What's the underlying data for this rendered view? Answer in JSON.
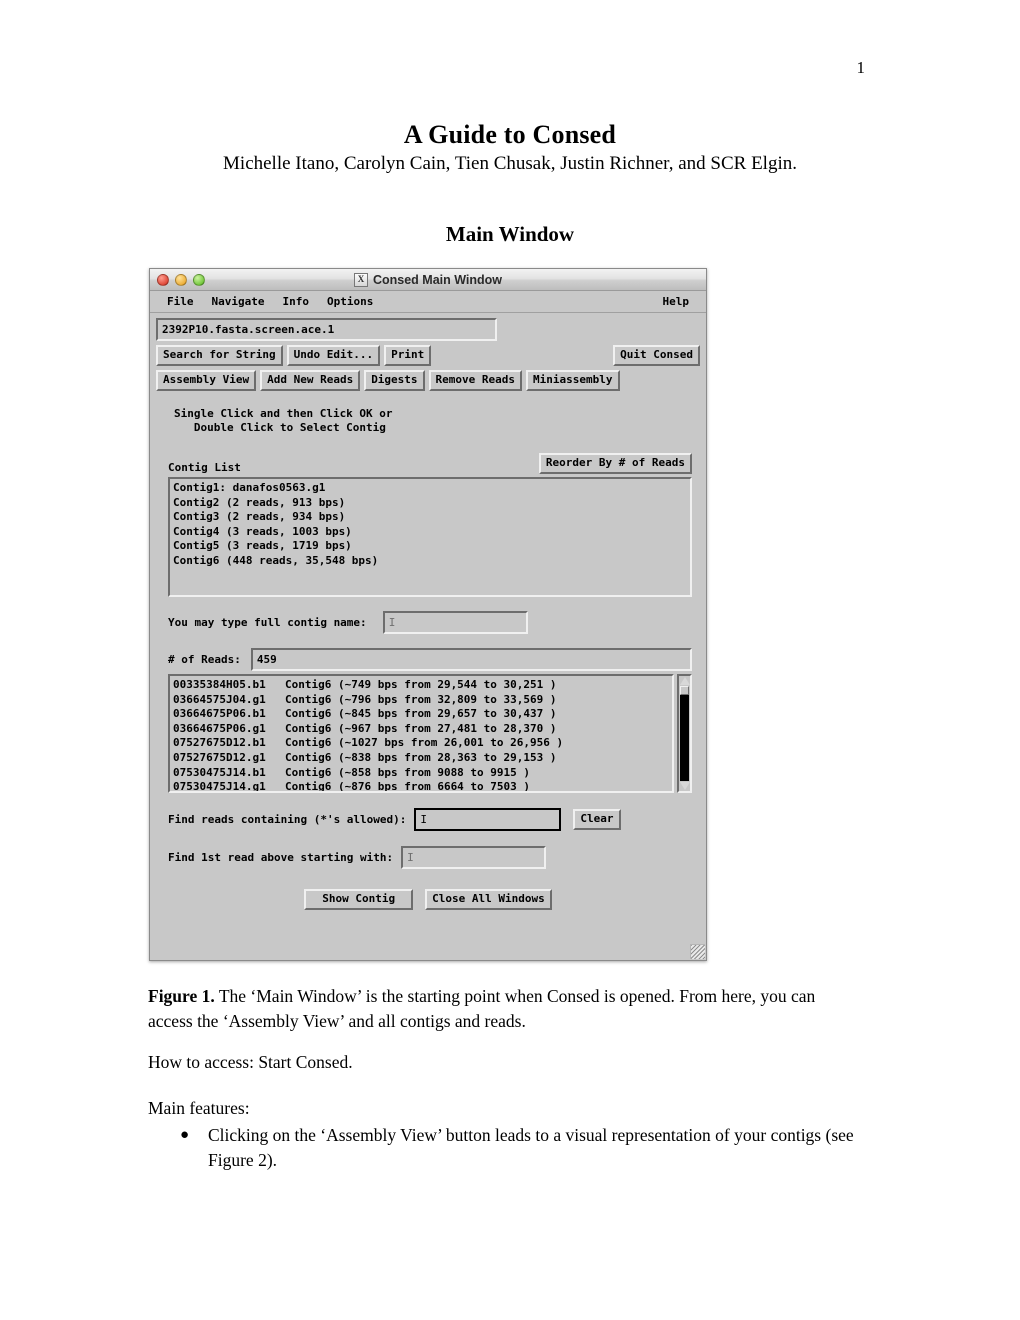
{
  "document": {
    "page_number": "1",
    "title": "A Guide to Consed",
    "authors": "Michelle Itano, Carolyn Cain, Tien Chusak, Justin Richner, and SCR Elgin.",
    "section_heading": "Main Window",
    "caption_label": "Figure 1.",
    "caption_text": "The ‘Main Window’ is the starting point when Consed is opened.  From here, you can access the ‘Assembly View’ and all contigs and reads.",
    "how_to_access": "How to access: Start Consed.",
    "features_label": "Main features:",
    "features": [
      "Clicking on the ‘Assembly View’ button leads to a visual representation of your contigs (see Figure 2)."
    ],
    "bullet_glyph": "●"
  },
  "window": {
    "title": "Consed Main Window",
    "x11_icon_glyph": "X",
    "traffic_lights": [
      {
        "name": "close",
        "color": "#e04a3a"
      },
      {
        "name": "minimize",
        "color": "#eeb13c"
      },
      {
        "name": "zoom",
        "color": "#76c93f"
      }
    ],
    "menus": [
      "File",
      "Navigate",
      "Info",
      "Options"
    ],
    "help_menu": "Help",
    "ace_file": "2392P10.fasta.screen.ace.1",
    "toolbar_row1": [
      "Search for String",
      "Undo Edit...",
      "Print"
    ],
    "quit_button": "Quit Consed",
    "toolbar_row2": [
      "Assembly View",
      "Add New Reads",
      "Digests",
      "Remove Reads",
      "Miniassembly"
    ],
    "hint_text": "Single Click and then Click OK or\n   Double Click to Select Contig",
    "contig_list_label": "Contig List",
    "reorder_button": "Reorder By # of Reads",
    "contigs": [
      "Contig1: danafos0563.g1",
      "Contig2 (2 reads, 913 bps)",
      "Contig3 (2 reads, 934 bps)",
      "Contig4 (3 reads, 1003 bps)",
      "Contig5 (3 reads, 1719 bps)",
      "Contig6 (448 reads, 35,548 bps)"
    ],
    "contig_name_label": "You may type full contig name:",
    "contig_name_value": "",
    "reads_count_label": "# of Reads:",
    "reads_count_value": "459",
    "reads": [
      {
        "name": "00335384H05.b1",
        "info": "Contig6 (~749 bps from 29,544 to 30,251 )"
      },
      {
        "name": "03664575J04.g1",
        "info": "Contig6 (~796 bps from 32,809 to 33,569 )"
      },
      {
        "name": "03664675P06.b1",
        "info": "Contig6 (~845 bps from 29,657 to 30,437 )"
      },
      {
        "name": "03664675P06.g1",
        "info": "Contig6 (~967 bps from 27,481 to 28,370 )"
      },
      {
        "name": "07527675D12.b1",
        "info": "Contig6 (~1027 bps from 26,001 to 26,956 )"
      },
      {
        "name": "07527675D12.g1",
        "info": "Contig6 (~838 bps from 28,363 to 29,153 )"
      },
      {
        "name": "07530475J14.b1",
        "info": "Contig6 (~858 bps from 9088 to 9915 )"
      },
      {
        "name": "07530475J14.g1",
        "info": "Contig6 (~876 bps from 6664 to 7503 )"
      }
    ],
    "find_reads_label": "Find reads containing (*'s allowed):",
    "find_reads_value": "",
    "clear_button": "Clear",
    "find_first_label": "Find 1st read above starting with:",
    "find_first_value": "",
    "show_contig_button": "Show Contig",
    "close_all_button": "Close All Windows",
    "caret_glyph": "I"
  }
}
